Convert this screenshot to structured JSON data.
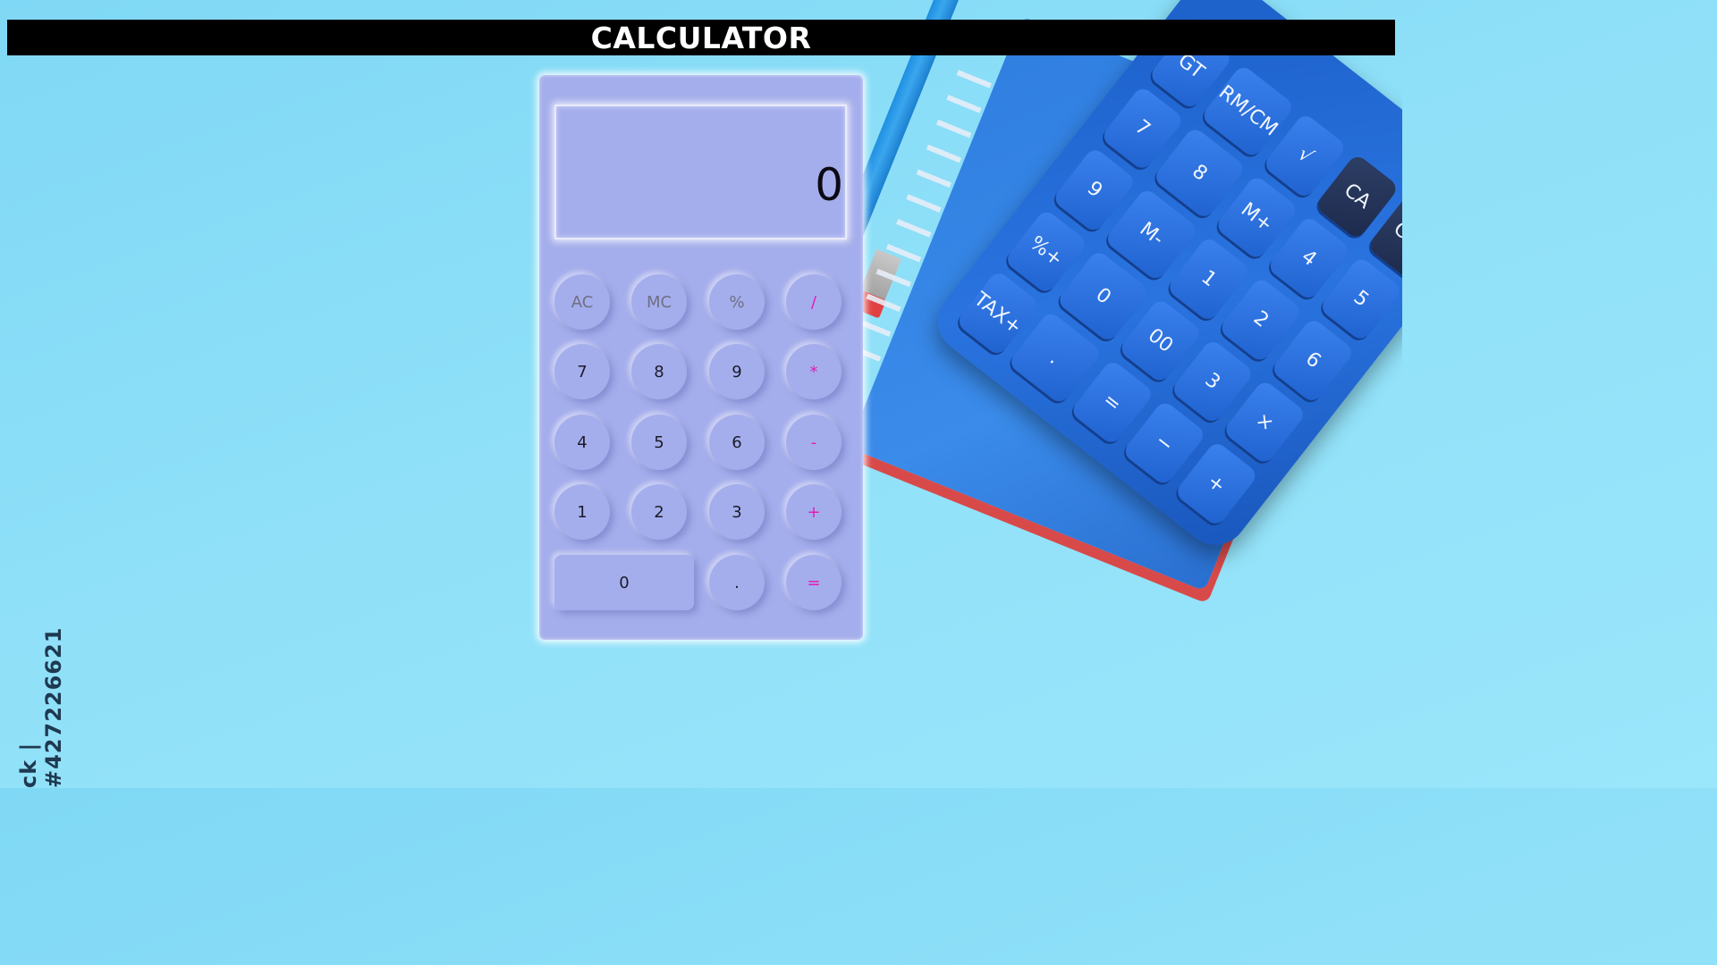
{
  "app": {
    "title": "CALCULATOR"
  },
  "display": {
    "value": "0"
  },
  "keys": {
    "ac": "AC",
    "mc": "MC",
    "percent": "%",
    "divide": "/",
    "seven": "7",
    "eight": "8",
    "nine": "9",
    "multiply": "*",
    "four": "4",
    "five": "5",
    "six": "6",
    "subtract": "-",
    "one": "1",
    "two": "2",
    "three": "3",
    "add": "+",
    "zero": "0",
    "decimal": ".",
    "equals": "="
  },
  "background": {
    "stock_id": "ck | #427226621",
    "device_keys": [
      "GT",
      "RM/CM",
      "√",
      "CA",
      "C/C",
      "7",
      "8",
      "M+",
      "4",
      "5",
      "9",
      "M-",
      "1",
      "2",
      "6",
      "%+",
      "0",
      "00",
      "3",
      "×",
      "TAX+",
      ".",
      "=",
      "−",
      "+"
    ]
  },
  "colors": {
    "page_bg": "#8fe0f8",
    "title_bar": "#000000",
    "calculator_body": "#a5aeec",
    "operator_text": "#e21cb5",
    "function_text": "#6f6f85"
  }
}
